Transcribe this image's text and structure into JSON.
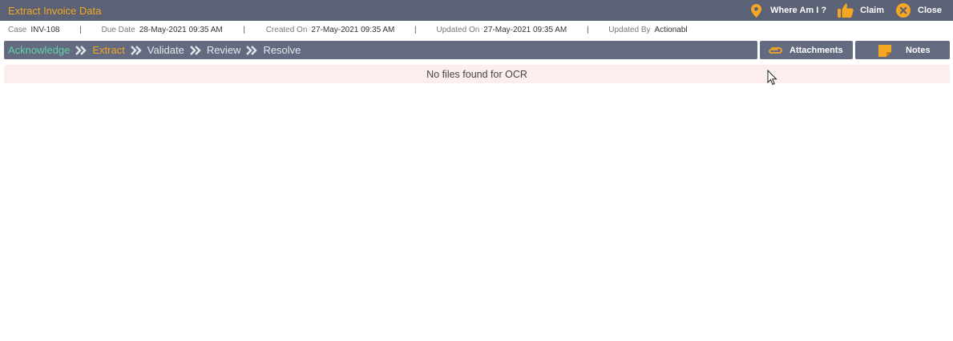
{
  "header": {
    "title": "Extract Invoice Data",
    "actions": {
      "where_am_i": "Where Am I ?",
      "claim": "Claim",
      "close": "Close"
    }
  },
  "meta": {
    "case_label": "Case",
    "case_value": "INV-108",
    "due_label": "Due Date",
    "due_value": "28-May-2021 09:35 AM",
    "created_label": "Created On",
    "created_value": "27-May-2021 09:35 AM",
    "updated_label": "Updated On",
    "updated_value": "27-May-2021 09:35 AM",
    "updated_by_label": "Updated By",
    "updated_by_value": "Actionabl",
    "separator": "|"
  },
  "stages": [
    {
      "label": "Acknowledge",
      "state": "done"
    },
    {
      "label": "Extract",
      "state": "current"
    },
    {
      "label": "Validate",
      "state": "todo"
    },
    {
      "label": "Review",
      "state": "todo"
    },
    {
      "label": "Resolve",
      "state": "todo"
    }
  ],
  "tabs": {
    "attachments": "Attachments",
    "notes": "Notes"
  },
  "message": "No files found for OCR",
  "colors": {
    "header_bg": "#5c6275",
    "accent": "#f5a623",
    "stage_done": "#5fd3a5",
    "message_bg": "#fdeeee"
  },
  "icons": {
    "where_am_i": "map-pin-icon",
    "claim": "thumbs-up-icon",
    "close": "close-circle-icon",
    "attachments": "paperclip-icon",
    "notes": "note-icon",
    "stage_separator": "double-chevron-right-icon"
  }
}
